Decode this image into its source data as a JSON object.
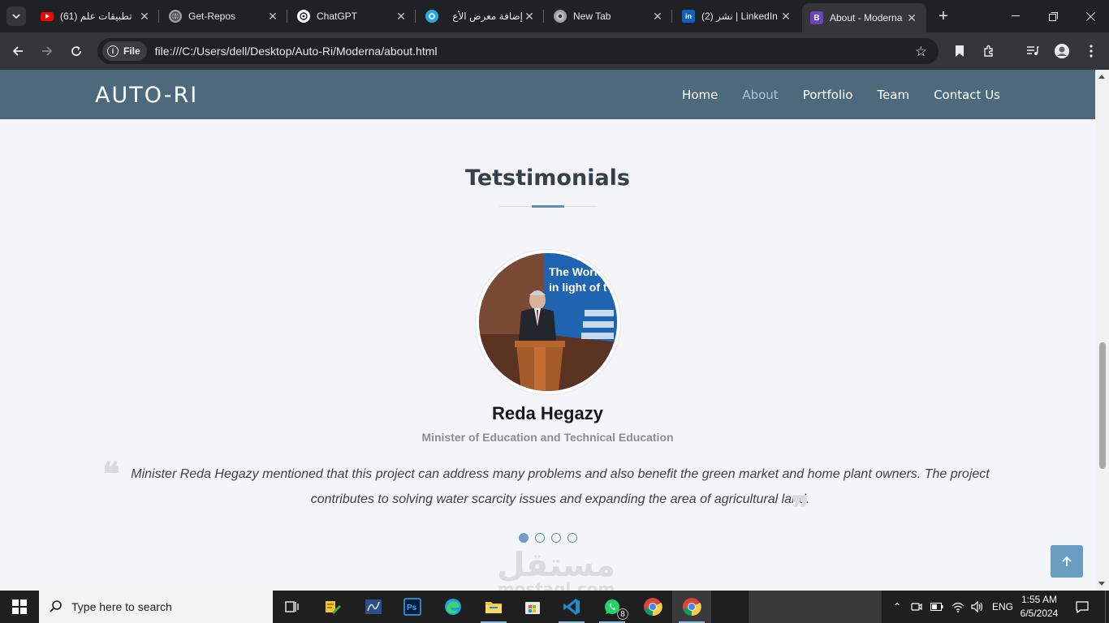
{
  "browser": {
    "tabs": [
      {
        "title": "(61) تطبيقات علم",
        "icon": "youtube-icon"
      },
      {
        "title": "Get-Repos",
        "icon": "globe-icon"
      },
      {
        "title": "ChatGPT",
        "icon": "chatgpt-icon"
      },
      {
        "title": "إضافة معرض الأع",
        "icon": "mostaql-icon"
      },
      {
        "title": "New Tab",
        "icon": "chrome-icon"
      },
      {
        "title": "(2) نشر | LinkedIn",
        "icon": "linkedin-icon"
      },
      {
        "title": "About - Moderna",
        "icon": "bootstrap-icon",
        "active": true
      }
    ],
    "new_tab_symbol": "+",
    "address": {
      "chip_label": "File",
      "url": "file:///C:/Users/dell/Desktop/Auto-Ri/Moderna/about.html"
    }
  },
  "site": {
    "logo": "AUTO-RI",
    "menu": [
      "Home",
      "About",
      "Portfolio",
      "Team",
      "Contact Us"
    ],
    "current_menu": "About"
  },
  "testimonials": {
    "title": "Tetstimonials",
    "name": "Reda Hegazy",
    "role": "Minister of Education and Technical Education",
    "quote": "Minister Reda Hegazy mentioned that this project can address many problems and also benefit the green market and home plant owners. The project contributes to solving water scarcity issues and expanding the area of agricultural land.",
    "photo_banner_lines": [
      "The Work",
      "in light of t"
    ],
    "slides_total": 4,
    "active_slide": 1
  },
  "watermark": {
    "main": "مستقل",
    "sub": "mostaql.com"
  },
  "taskbar": {
    "search_placeholder": "Type here to search",
    "whatsapp_badge": "8",
    "language": "ENG",
    "time": "1:55 AM",
    "date": "6/5/2024"
  },
  "colors": {
    "site_nav": "#4c6a7b",
    "accent": "#5f8fb1",
    "back_to_top": "#6a9ec0"
  }
}
